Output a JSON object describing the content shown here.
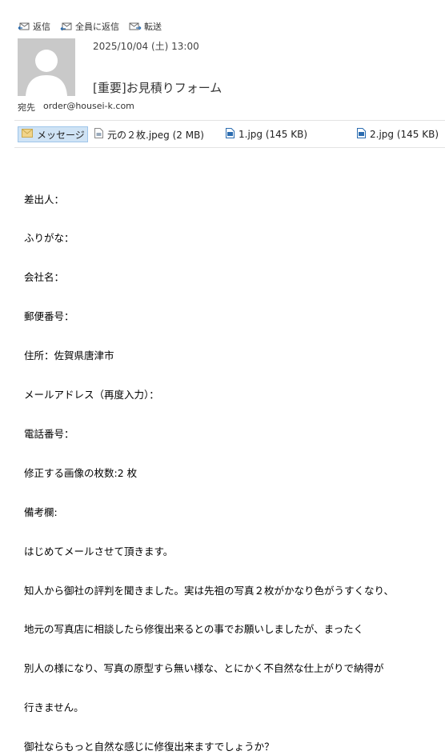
{
  "toolbar": {
    "reply": "返信",
    "reply_all": "全員に返信",
    "forward": "転送"
  },
  "header": {
    "date": "2025/10/04 (土) 13:00",
    "subject": "[重要]お見積りフォーム",
    "to_label": "宛先",
    "to_address": "order@housei-k.com"
  },
  "attachments": {
    "message_tab": "メッセージ",
    "items": [
      {
        "name": "元の２枚.jpeg (2 MB)"
      },
      {
        "name": "1.jpg (145 KB)"
      },
      {
        "name": "2.jpg (145 KB)"
      }
    ]
  },
  "body": {
    "lines": [
      "差出人：",
      "ふりがな：",
      "会社名：",
      "郵便番号：",
      "住所：佐賀県唐津市",
      "メールアドレス（再度入力）：",
      "電話番号：",
      "修正する画像の枚数:2 枚",
      "備考欄:",
      "はじめてメールさせて頂きます。",
      "知人から御社の評判を聞きました。実は先祖の写真２枚がかなり色がうすくなり、",
      "地元の写真店に相談したら修復出来るとの事でお願いしましたが、まったく",
      "別人の様になり、写真の原型すら無い様な、とにかく不自然な仕上がりで納得が",
      "行きません。",
      "御社ならもっと自然な感じに修復出来ますでしょうか？"
    ]
  }
}
